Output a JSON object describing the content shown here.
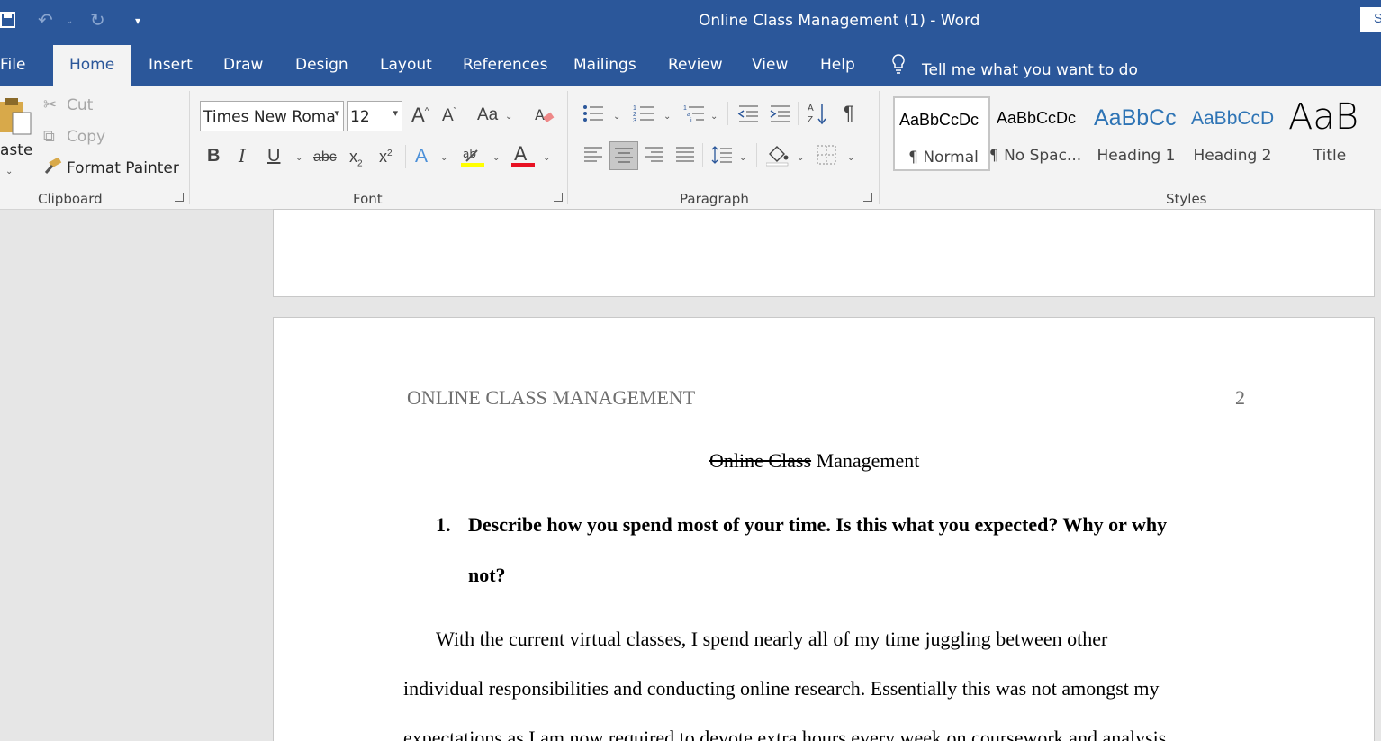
{
  "window": {
    "title": "Online Class Management (1)  -  Word",
    "share_label": "S"
  },
  "tabs": [
    "File",
    "Home",
    "Insert",
    "Draw",
    "Design",
    "Layout",
    "References",
    "Mailings",
    "Review",
    "View",
    "Help"
  ],
  "active_tab": "Home",
  "tell_me": "Tell me what you want to do",
  "clipboard": {
    "paste_label": "aste",
    "cut_label": "Cut",
    "copy_label": "Copy",
    "format_painter_label": "Format Painter",
    "group_label": "Clipboard"
  },
  "font": {
    "font_name": "Times New Roma",
    "font_size": "12",
    "group_label": "Font",
    "font_color": "#e81123",
    "highlight_color": "#ffff00"
  },
  "paragraph": {
    "group_label": "Paragraph"
  },
  "styles": {
    "group_label": "Styles",
    "items": [
      {
        "sample": "AaBbCcDc",
        "name": "¶ Normal"
      },
      {
        "sample": "AaBbCcDc",
        "name": "¶ No Spac..."
      },
      {
        "sample": "AaBbCc",
        "name": "Heading 1"
      },
      {
        "sample": "AaBbCcD",
        "name": "Heading 2"
      },
      {
        "sample": "AaB",
        "name": "Title"
      }
    ]
  },
  "document": {
    "running_head": "ONLINE CLASS MANAGEMENT",
    "page_number": "2",
    "title_struck": "Online Class",
    "title_rest": " Management",
    "question_number": "1.",
    "question_line1": "Describe how you spend most of your time. Is this what you expected? Why or why",
    "question_line2": "not?",
    "body_line1": "With the current virtual classes, I spend nearly all of my time juggling between other",
    "body_line2": "individual responsibilities and conducting online research. Essentially this was not amongst my",
    "body_line3": "expectations as I am now required to devote extra hours every week on coursework and analysis"
  },
  "colors": {
    "word_blue": "#2b579a",
    "ribbon_bg": "#f3f3f3",
    "canvas_bg": "#e6e6e6"
  }
}
